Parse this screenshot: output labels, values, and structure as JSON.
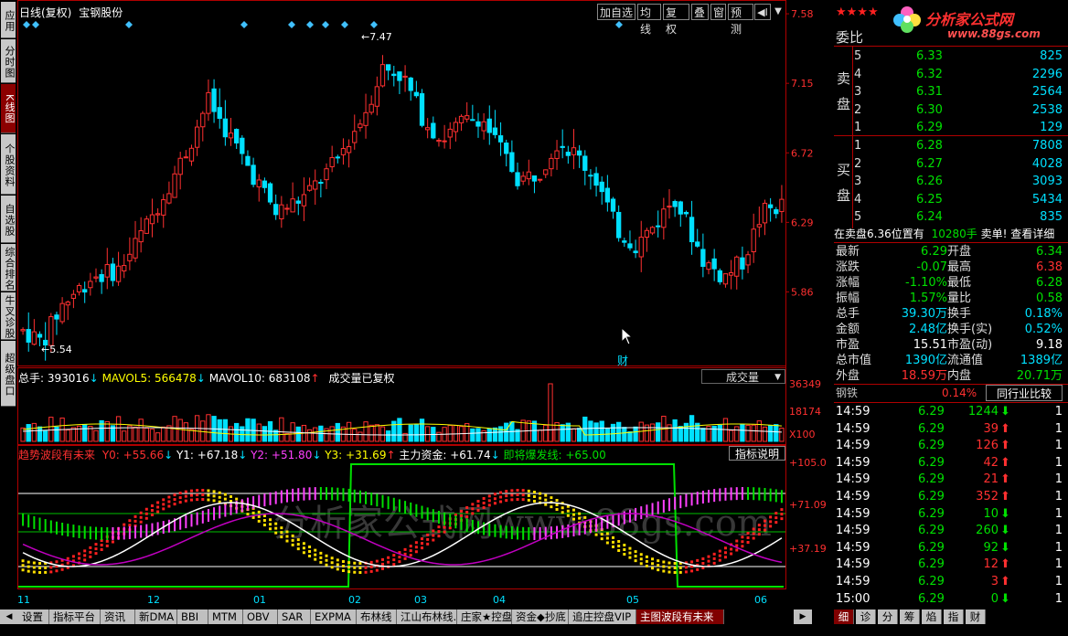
{
  "left_tabs": [
    {
      "label": "应用",
      "active": false
    },
    {
      "label": "分时图",
      "active": false
    },
    {
      "label": "K线图",
      "active": true
    },
    {
      "label": "个股资料",
      "active": false
    },
    {
      "label": "自选股",
      "active": false
    },
    {
      "label": "综合排名",
      "active": false
    },
    {
      "label": "牛叉诊股",
      "active": false
    },
    {
      "label": "超级盘口",
      "active": false
    }
  ],
  "chart_header": {
    "period": "日线(复权)",
    "stock_name": "宝钢股份"
  },
  "toolbar": [
    "加自选",
    "均线",
    "复权",
    "叠",
    "窗",
    "预测"
  ],
  "price_axis": [
    "7.58",
    "7.15",
    "6.72",
    "6.29",
    "5.86"
  ],
  "high_label": "7.47",
  "low_label": "5.54",
  "cai_marker": "财",
  "volume_header": {
    "total": "总手: 393016",
    "mavol5": "MAVOL5: 566478",
    "mavol10": "MAVOL10: 683108",
    "note": "成交量已复权"
  },
  "volume_selector": "成交量",
  "volume_axis": [
    "36349",
    "18174",
    "X100"
  ],
  "indicator_header": {
    "name": "趋势波段有未来",
    "y0": "Y0: +55.66",
    "y1": "Y1: +67.18",
    "y2": "Y2: +51.80",
    "y3": "Y3: +31.69",
    "main": "主力资金: +61.74",
    "burst": "即将爆发线: +65.00"
  },
  "indicator_button": "指标说明",
  "indicator_axis": [
    "+105.0",
    "+71.09",
    "+37.19"
  ],
  "watermark": "分析家公式网www.88gs.com",
  "date_axis": [
    "11",
    "12",
    "01",
    "02",
    "03",
    "04",
    "05",
    "06"
  ],
  "logo": {
    "stars": "★★★★",
    "text": "分析家公式网",
    "url": "www.88gs.com"
  },
  "weibi_label": "委比",
  "sell_label": "卖盘",
  "buy_label": "买盘",
  "sell_orders": [
    {
      "level": "5",
      "price": "6.33",
      "vol": "825"
    },
    {
      "level": "4",
      "price": "6.32",
      "vol": "2296"
    },
    {
      "level": "3",
      "price": "6.31",
      "vol": "2564"
    },
    {
      "level": "2",
      "price": "6.30",
      "vol": "2538"
    },
    {
      "level": "1",
      "price": "6.29",
      "vol": "129"
    }
  ],
  "buy_orders": [
    {
      "level": "1",
      "price": "6.28",
      "vol": "7808"
    },
    {
      "level": "2",
      "price": "6.27",
      "vol": "4028"
    },
    {
      "level": "3",
      "price": "6.26",
      "vol": "3093"
    },
    {
      "level": "4",
      "price": "6.25",
      "vol": "5434"
    },
    {
      "level": "5",
      "price": "6.24",
      "vol": "835"
    }
  ],
  "big_order": {
    "text1": "在卖盘6.36位置有",
    "text2": "10280手",
    "text3": "卖单!",
    "text4": "查看详细"
  },
  "quote_rows": [
    {
      "l1": "最新",
      "v1": "6.29",
      "c1": "green",
      "l2": "开盘",
      "v2": "6.34",
      "c2": "green"
    },
    {
      "l1": "涨跌",
      "v1": "-0.07",
      "c1": "green",
      "l2": "最高",
      "v2": "6.38",
      "c2": "red"
    },
    {
      "l1": "涨幅",
      "v1": "-1.10%",
      "c1": "green",
      "l2": "最低",
      "v2": "6.28",
      "c2": "green"
    },
    {
      "l1": "振幅",
      "v1": "1.57%",
      "c1": "green",
      "l2": "量比",
      "v2": "0.58",
      "c2": "green"
    },
    {
      "l1": "总手",
      "v1": "39.30万",
      "c1": "cyan",
      "l2": "换手",
      "v2": "0.18%",
      "c2": "cyan"
    },
    {
      "l1": "金额",
      "v1": "2.48亿",
      "c1": "cyan",
      "l2": "换手(实)",
      "v2": "0.52%",
      "c2": "cyan"
    },
    {
      "l1": "市盈",
      "v1": "15.51",
      "c1": "white",
      "l2": "市盈(动)",
      "v2": "9.18",
      "c2": "white"
    },
    {
      "l1": "总市值",
      "v1": "1390亿",
      "c1": "cyan",
      "l2": "流通值",
      "v2": "1389亿",
      "c2": "cyan"
    },
    {
      "l1": "外盘",
      "v1": "18.59万",
      "c1": "red",
      "l2": "内盘",
      "v2": "20.71万",
      "c2": "green"
    }
  ],
  "industry": {
    "name": "钢铁",
    "change": "0.14%",
    "button": "同行业比较"
  },
  "ticks": [
    {
      "time": "14:59",
      "price": "6.29",
      "vol": "1244",
      "dir": "down",
      "n": "1"
    },
    {
      "time": "14:59",
      "price": "6.29",
      "vol": "39",
      "dir": "up",
      "n": "1"
    },
    {
      "time": "14:59",
      "price": "6.29",
      "vol": "126",
      "dir": "up",
      "n": "1"
    },
    {
      "time": "14:59",
      "price": "6.29",
      "vol": "42",
      "dir": "up",
      "n": "1"
    },
    {
      "time": "14:59",
      "price": "6.29",
      "vol": "21",
      "dir": "up",
      "n": "1"
    },
    {
      "time": "14:59",
      "price": "6.29",
      "vol": "352",
      "dir": "up",
      "n": "1"
    },
    {
      "time": "14:59",
      "price": "6.29",
      "vol": "10",
      "dir": "down",
      "n": "1"
    },
    {
      "time": "14:59",
      "price": "6.29",
      "vol": "260",
      "dir": "down",
      "n": "1"
    },
    {
      "time": "14:59",
      "price": "6.29",
      "vol": "92",
      "dir": "down",
      "n": "1"
    },
    {
      "time": "14:59",
      "price": "6.29",
      "vol": "12",
      "dir": "up",
      "n": "1"
    },
    {
      "time": "14:59",
      "price": "6.29",
      "vol": "3",
      "dir": "up",
      "n": "1"
    },
    {
      "time": "15:00",
      "price": "6.29",
      "vol": "0",
      "dir": "down",
      "n": "1"
    }
  ],
  "bottom_tabs": [
    {
      "label": "设置",
      "active": false
    },
    {
      "label": "指标平台",
      "active": false
    },
    {
      "label": "资讯",
      "active": false
    },
    {
      "label": "新DMA",
      "active": false
    },
    {
      "label": "BBI",
      "active": false
    },
    {
      "label": "MTM",
      "active": false
    },
    {
      "label": "OBV",
      "active": false
    },
    {
      "label": "SAR",
      "active": false
    },
    {
      "label": "EXPMA",
      "active": false
    },
    {
      "label": "布林线",
      "active": false
    },
    {
      "label": "江山布林线...",
      "active": false
    },
    {
      "label": "庄家★控盘",
      "active": false
    },
    {
      "label": "资金◆抄底",
      "active": false
    },
    {
      "label": "追庄控盘VIP",
      "active": false
    },
    {
      "label": "主图波段有未来",
      "active": true
    }
  ],
  "right_bottom_tabs": [
    "细",
    "诊",
    "分",
    "筹",
    "焰",
    "指",
    "财"
  ],
  "colors": {
    "up": "#ff3030",
    "down": "#00e0ff",
    "border": "#b00000",
    "green": "#00e000"
  }
}
